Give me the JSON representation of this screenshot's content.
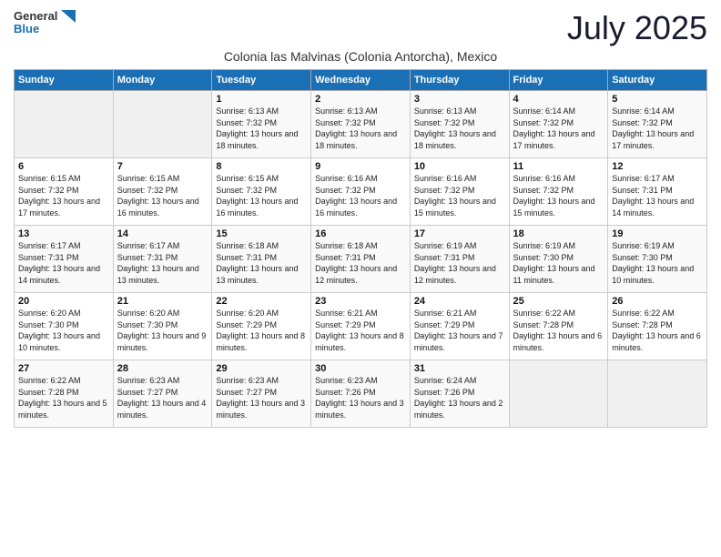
{
  "logo": {
    "text_general": "General",
    "text_blue": "Blue"
  },
  "title": "July 2025",
  "subtitle": "Colonia las Malvinas (Colonia Antorcha), Mexico",
  "days_of_week": [
    "Sunday",
    "Monday",
    "Tuesday",
    "Wednesday",
    "Thursday",
    "Friday",
    "Saturday"
  ],
  "weeks": [
    [
      {
        "day": "",
        "info": ""
      },
      {
        "day": "",
        "info": ""
      },
      {
        "day": "1",
        "info": "Sunrise: 6:13 AM\nSunset: 7:32 PM\nDaylight: 13 hours and 18 minutes."
      },
      {
        "day": "2",
        "info": "Sunrise: 6:13 AM\nSunset: 7:32 PM\nDaylight: 13 hours and 18 minutes."
      },
      {
        "day": "3",
        "info": "Sunrise: 6:13 AM\nSunset: 7:32 PM\nDaylight: 13 hours and 18 minutes."
      },
      {
        "day": "4",
        "info": "Sunrise: 6:14 AM\nSunset: 7:32 PM\nDaylight: 13 hours and 17 minutes."
      },
      {
        "day": "5",
        "info": "Sunrise: 6:14 AM\nSunset: 7:32 PM\nDaylight: 13 hours and 17 minutes."
      }
    ],
    [
      {
        "day": "6",
        "info": "Sunrise: 6:15 AM\nSunset: 7:32 PM\nDaylight: 13 hours and 17 minutes."
      },
      {
        "day": "7",
        "info": "Sunrise: 6:15 AM\nSunset: 7:32 PM\nDaylight: 13 hours and 16 minutes."
      },
      {
        "day": "8",
        "info": "Sunrise: 6:15 AM\nSunset: 7:32 PM\nDaylight: 13 hours and 16 minutes."
      },
      {
        "day": "9",
        "info": "Sunrise: 6:16 AM\nSunset: 7:32 PM\nDaylight: 13 hours and 16 minutes."
      },
      {
        "day": "10",
        "info": "Sunrise: 6:16 AM\nSunset: 7:32 PM\nDaylight: 13 hours and 15 minutes."
      },
      {
        "day": "11",
        "info": "Sunrise: 6:16 AM\nSunset: 7:32 PM\nDaylight: 13 hours and 15 minutes."
      },
      {
        "day": "12",
        "info": "Sunrise: 6:17 AM\nSunset: 7:31 PM\nDaylight: 13 hours and 14 minutes."
      }
    ],
    [
      {
        "day": "13",
        "info": "Sunrise: 6:17 AM\nSunset: 7:31 PM\nDaylight: 13 hours and 14 minutes."
      },
      {
        "day": "14",
        "info": "Sunrise: 6:17 AM\nSunset: 7:31 PM\nDaylight: 13 hours and 13 minutes."
      },
      {
        "day": "15",
        "info": "Sunrise: 6:18 AM\nSunset: 7:31 PM\nDaylight: 13 hours and 13 minutes."
      },
      {
        "day": "16",
        "info": "Sunrise: 6:18 AM\nSunset: 7:31 PM\nDaylight: 13 hours and 12 minutes."
      },
      {
        "day": "17",
        "info": "Sunrise: 6:19 AM\nSunset: 7:31 PM\nDaylight: 13 hours and 12 minutes."
      },
      {
        "day": "18",
        "info": "Sunrise: 6:19 AM\nSunset: 7:30 PM\nDaylight: 13 hours and 11 minutes."
      },
      {
        "day": "19",
        "info": "Sunrise: 6:19 AM\nSunset: 7:30 PM\nDaylight: 13 hours and 10 minutes."
      }
    ],
    [
      {
        "day": "20",
        "info": "Sunrise: 6:20 AM\nSunset: 7:30 PM\nDaylight: 13 hours and 10 minutes."
      },
      {
        "day": "21",
        "info": "Sunrise: 6:20 AM\nSunset: 7:30 PM\nDaylight: 13 hours and 9 minutes."
      },
      {
        "day": "22",
        "info": "Sunrise: 6:20 AM\nSunset: 7:29 PM\nDaylight: 13 hours and 8 minutes."
      },
      {
        "day": "23",
        "info": "Sunrise: 6:21 AM\nSunset: 7:29 PM\nDaylight: 13 hours and 8 minutes."
      },
      {
        "day": "24",
        "info": "Sunrise: 6:21 AM\nSunset: 7:29 PM\nDaylight: 13 hours and 7 minutes."
      },
      {
        "day": "25",
        "info": "Sunrise: 6:22 AM\nSunset: 7:28 PM\nDaylight: 13 hours and 6 minutes."
      },
      {
        "day": "26",
        "info": "Sunrise: 6:22 AM\nSunset: 7:28 PM\nDaylight: 13 hours and 6 minutes."
      }
    ],
    [
      {
        "day": "27",
        "info": "Sunrise: 6:22 AM\nSunset: 7:28 PM\nDaylight: 13 hours and 5 minutes."
      },
      {
        "day": "28",
        "info": "Sunrise: 6:23 AM\nSunset: 7:27 PM\nDaylight: 13 hours and 4 minutes."
      },
      {
        "day": "29",
        "info": "Sunrise: 6:23 AM\nSunset: 7:27 PM\nDaylight: 13 hours and 3 minutes."
      },
      {
        "day": "30",
        "info": "Sunrise: 6:23 AM\nSunset: 7:26 PM\nDaylight: 13 hours and 3 minutes."
      },
      {
        "day": "31",
        "info": "Sunrise: 6:24 AM\nSunset: 7:26 PM\nDaylight: 13 hours and 2 minutes."
      },
      {
        "day": "",
        "info": ""
      },
      {
        "day": "",
        "info": ""
      }
    ]
  ]
}
